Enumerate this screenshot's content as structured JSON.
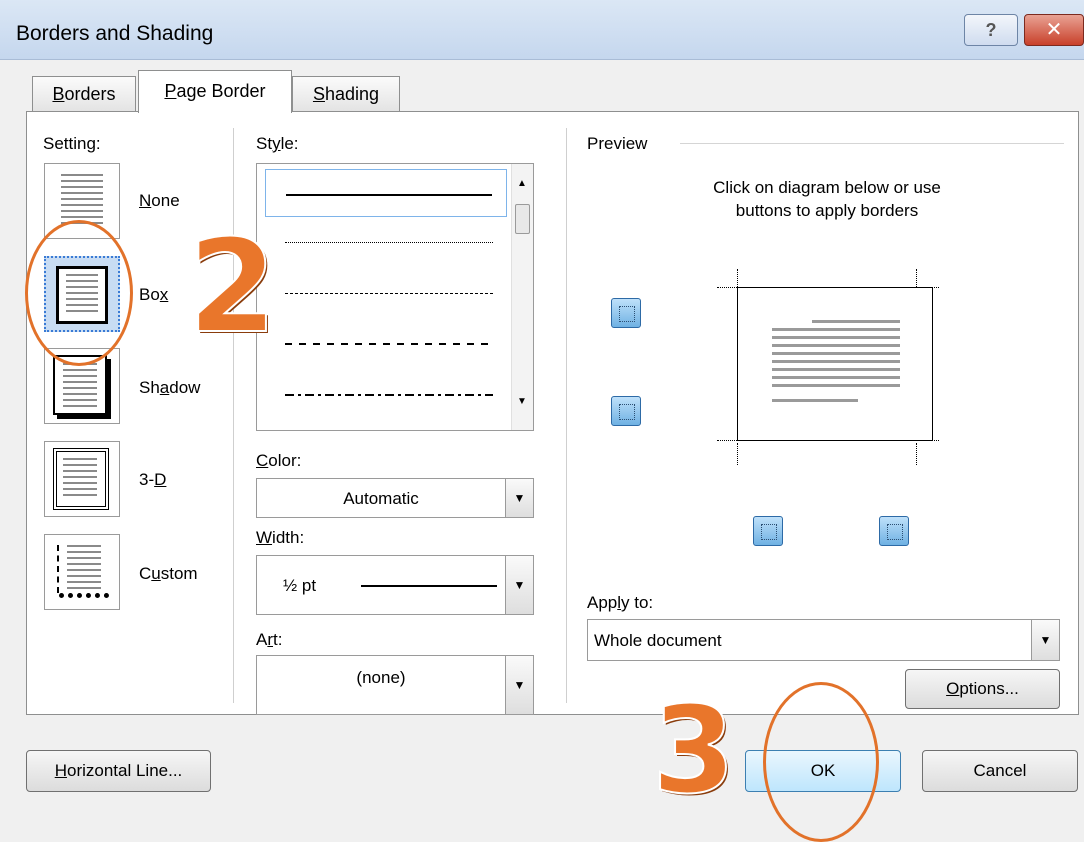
{
  "window": {
    "title": "Borders and Shading",
    "help_glyph": "?",
    "close_glyph": "✕"
  },
  "tabs": [
    {
      "label_prefix": "",
      "label_u": "B",
      "label_rest": "orders"
    },
    {
      "label_prefix": "",
      "label_u": "P",
      "label_rest": "age Border"
    },
    {
      "label_prefix": "",
      "label_u": "S",
      "label_rest": "hading"
    }
  ],
  "setting": {
    "heading": "Setting:",
    "options": [
      {
        "pre": "",
        "u": "N",
        "post": "one"
      },
      {
        "pre": "Bo",
        "u": "x",
        "post": ""
      },
      {
        "pre": "Sh",
        "u": "a",
        "post": "dow"
      },
      {
        "pre": "3-",
        "u": "D",
        "post": ""
      },
      {
        "pre": "C",
        "u": "u",
        "post": "stom"
      }
    ]
  },
  "style": {
    "heading_pre": "St",
    "heading_u": "y",
    "heading_post": "le:"
  },
  "color": {
    "label_u": "C",
    "label_rest": "olor:",
    "value": "Automatic"
  },
  "width": {
    "label_u": "W",
    "label_rest": "idth:",
    "value": "½ pt"
  },
  "art": {
    "label_pre": "A",
    "label_u": "r",
    "label_post": "t:",
    "value": "(none)"
  },
  "preview": {
    "heading": "Preview",
    "hint_line1": "Click on diagram below or use",
    "hint_line2": "buttons to apply borders"
  },
  "apply_to": {
    "label_pre": "App",
    "label_u": "l",
    "label_post": "y to:",
    "value": "Whole document"
  },
  "buttons": {
    "options_u": "O",
    "options_rest": "ptions...",
    "horizontal_u": "H",
    "horizontal_rest": "orizontal Line...",
    "ok": "OK",
    "cancel": "Cancel"
  },
  "annotations": {
    "step2": "2",
    "step3": "3",
    "accent_color": "#e9762b"
  }
}
